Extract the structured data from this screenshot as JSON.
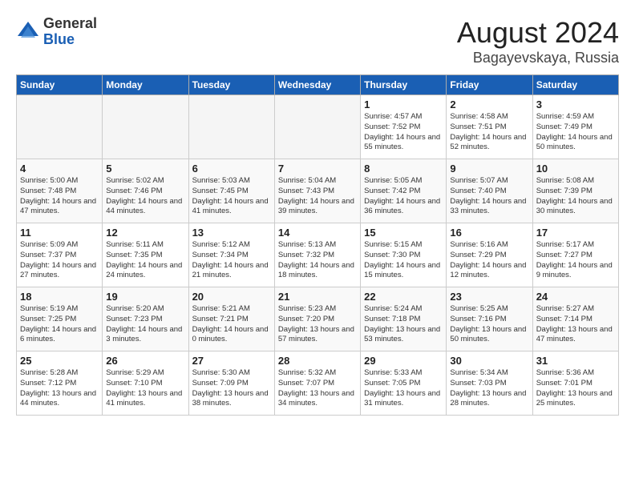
{
  "header": {
    "logo_general": "General",
    "logo_blue": "Blue",
    "month_year": "August 2024",
    "location": "Bagayevskaya, Russia"
  },
  "days_of_week": [
    "Sunday",
    "Monday",
    "Tuesday",
    "Wednesday",
    "Thursday",
    "Friday",
    "Saturday"
  ],
  "weeks": [
    [
      {
        "day": "",
        "empty": true
      },
      {
        "day": "",
        "empty": true
      },
      {
        "day": "",
        "empty": true
      },
      {
        "day": "",
        "empty": true
      },
      {
        "day": "1",
        "sunrise": "4:57 AM",
        "sunset": "7:52 PM",
        "daylight": "14 hours and 55 minutes."
      },
      {
        "day": "2",
        "sunrise": "4:58 AM",
        "sunset": "7:51 PM",
        "daylight": "14 hours and 52 minutes."
      },
      {
        "day": "3",
        "sunrise": "4:59 AM",
        "sunset": "7:49 PM",
        "daylight": "14 hours and 50 minutes."
      }
    ],
    [
      {
        "day": "4",
        "sunrise": "5:00 AM",
        "sunset": "7:48 PM",
        "daylight": "14 hours and 47 minutes."
      },
      {
        "day": "5",
        "sunrise": "5:02 AM",
        "sunset": "7:46 PM",
        "daylight": "14 hours and 44 minutes."
      },
      {
        "day": "6",
        "sunrise": "5:03 AM",
        "sunset": "7:45 PM",
        "daylight": "14 hours and 41 minutes."
      },
      {
        "day": "7",
        "sunrise": "5:04 AM",
        "sunset": "7:43 PM",
        "daylight": "14 hours and 39 minutes."
      },
      {
        "day": "8",
        "sunrise": "5:05 AM",
        "sunset": "7:42 PM",
        "daylight": "14 hours and 36 minutes."
      },
      {
        "day": "9",
        "sunrise": "5:07 AM",
        "sunset": "7:40 PM",
        "daylight": "14 hours and 33 minutes."
      },
      {
        "day": "10",
        "sunrise": "5:08 AM",
        "sunset": "7:39 PM",
        "daylight": "14 hours and 30 minutes."
      }
    ],
    [
      {
        "day": "11",
        "sunrise": "5:09 AM",
        "sunset": "7:37 PM",
        "daylight": "14 hours and 27 minutes."
      },
      {
        "day": "12",
        "sunrise": "5:11 AM",
        "sunset": "7:35 PM",
        "daylight": "14 hours and 24 minutes."
      },
      {
        "day": "13",
        "sunrise": "5:12 AM",
        "sunset": "7:34 PM",
        "daylight": "14 hours and 21 minutes."
      },
      {
        "day": "14",
        "sunrise": "5:13 AM",
        "sunset": "7:32 PM",
        "daylight": "14 hours and 18 minutes."
      },
      {
        "day": "15",
        "sunrise": "5:15 AM",
        "sunset": "7:30 PM",
        "daylight": "14 hours and 15 minutes."
      },
      {
        "day": "16",
        "sunrise": "5:16 AM",
        "sunset": "7:29 PM",
        "daylight": "14 hours and 12 minutes."
      },
      {
        "day": "17",
        "sunrise": "5:17 AM",
        "sunset": "7:27 PM",
        "daylight": "14 hours and 9 minutes."
      }
    ],
    [
      {
        "day": "18",
        "sunrise": "5:19 AM",
        "sunset": "7:25 PM",
        "daylight": "14 hours and 6 minutes."
      },
      {
        "day": "19",
        "sunrise": "5:20 AM",
        "sunset": "7:23 PM",
        "daylight": "14 hours and 3 minutes."
      },
      {
        "day": "20",
        "sunrise": "5:21 AM",
        "sunset": "7:21 PM",
        "daylight": "14 hours and 0 minutes."
      },
      {
        "day": "21",
        "sunrise": "5:23 AM",
        "sunset": "7:20 PM",
        "daylight": "13 hours and 57 minutes."
      },
      {
        "day": "22",
        "sunrise": "5:24 AM",
        "sunset": "7:18 PM",
        "daylight": "13 hours and 53 minutes."
      },
      {
        "day": "23",
        "sunrise": "5:25 AM",
        "sunset": "7:16 PM",
        "daylight": "13 hours and 50 minutes."
      },
      {
        "day": "24",
        "sunrise": "5:27 AM",
        "sunset": "7:14 PM",
        "daylight": "13 hours and 47 minutes."
      }
    ],
    [
      {
        "day": "25",
        "sunrise": "5:28 AM",
        "sunset": "7:12 PM",
        "daylight": "13 hours and 44 minutes."
      },
      {
        "day": "26",
        "sunrise": "5:29 AM",
        "sunset": "7:10 PM",
        "daylight": "13 hours and 41 minutes."
      },
      {
        "day": "27",
        "sunrise": "5:30 AM",
        "sunset": "7:09 PM",
        "daylight": "13 hours and 38 minutes."
      },
      {
        "day": "28",
        "sunrise": "5:32 AM",
        "sunset": "7:07 PM",
        "daylight": "13 hours and 34 minutes."
      },
      {
        "day": "29",
        "sunrise": "5:33 AM",
        "sunset": "7:05 PM",
        "daylight": "13 hours and 31 minutes."
      },
      {
        "day": "30",
        "sunrise": "5:34 AM",
        "sunset": "7:03 PM",
        "daylight": "13 hours and 28 minutes."
      },
      {
        "day": "31",
        "sunrise": "5:36 AM",
        "sunset": "7:01 PM",
        "daylight": "13 hours and 25 minutes."
      }
    ]
  ]
}
